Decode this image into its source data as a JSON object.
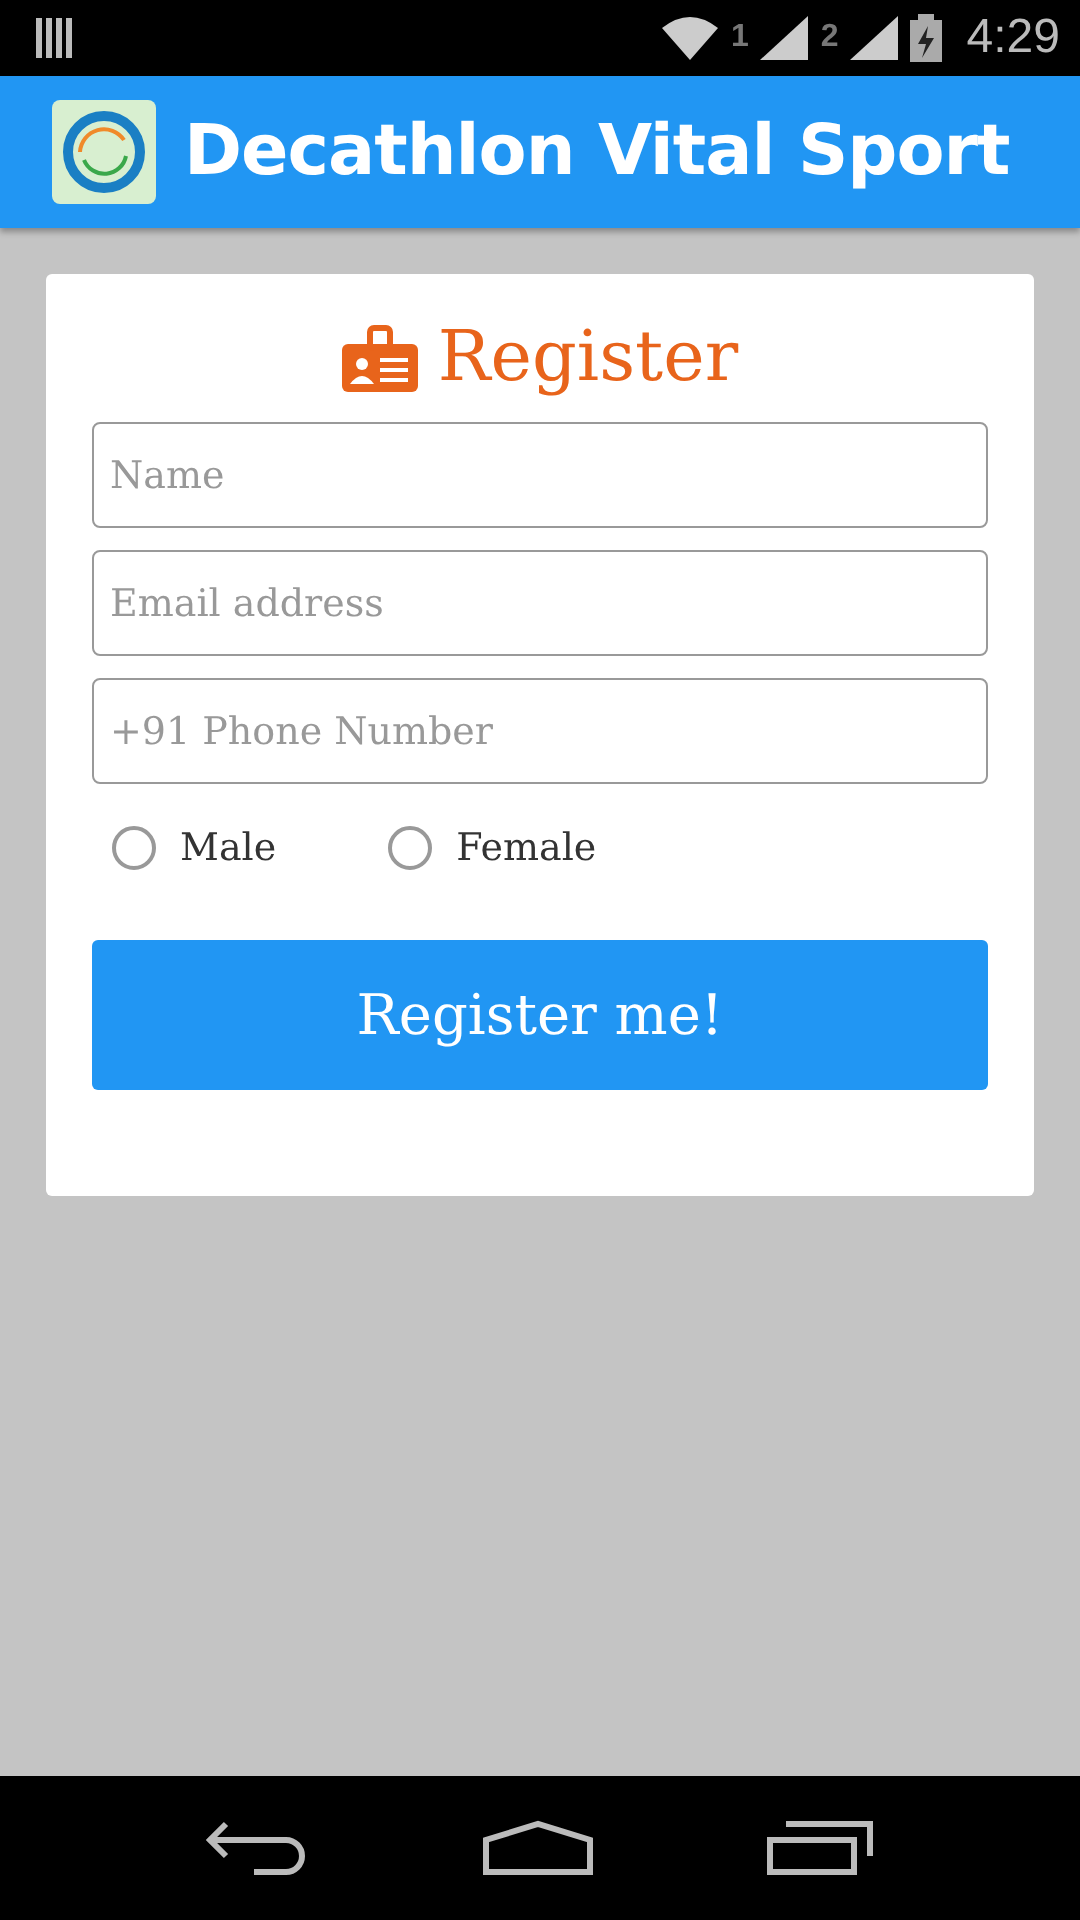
{
  "status_bar": {
    "sim_1": "1",
    "sim_2": "2",
    "time": "4:29"
  },
  "app_bar": {
    "title": "Decathlon Vital Sport"
  },
  "form": {
    "title": "Register",
    "fields": [
      {
        "placeholder": "Name"
      },
      {
        "placeholder": "Email address"
      },
      {
        "placeholder": "+91 Phone Number"
      }
    ],
    "gender": [
      {
        "label": "Male",
        "selected": false
      },
      {
        "label": "Female",
        "selected": false
      }
    ],
    "submit": "Register me!"
  }
}
